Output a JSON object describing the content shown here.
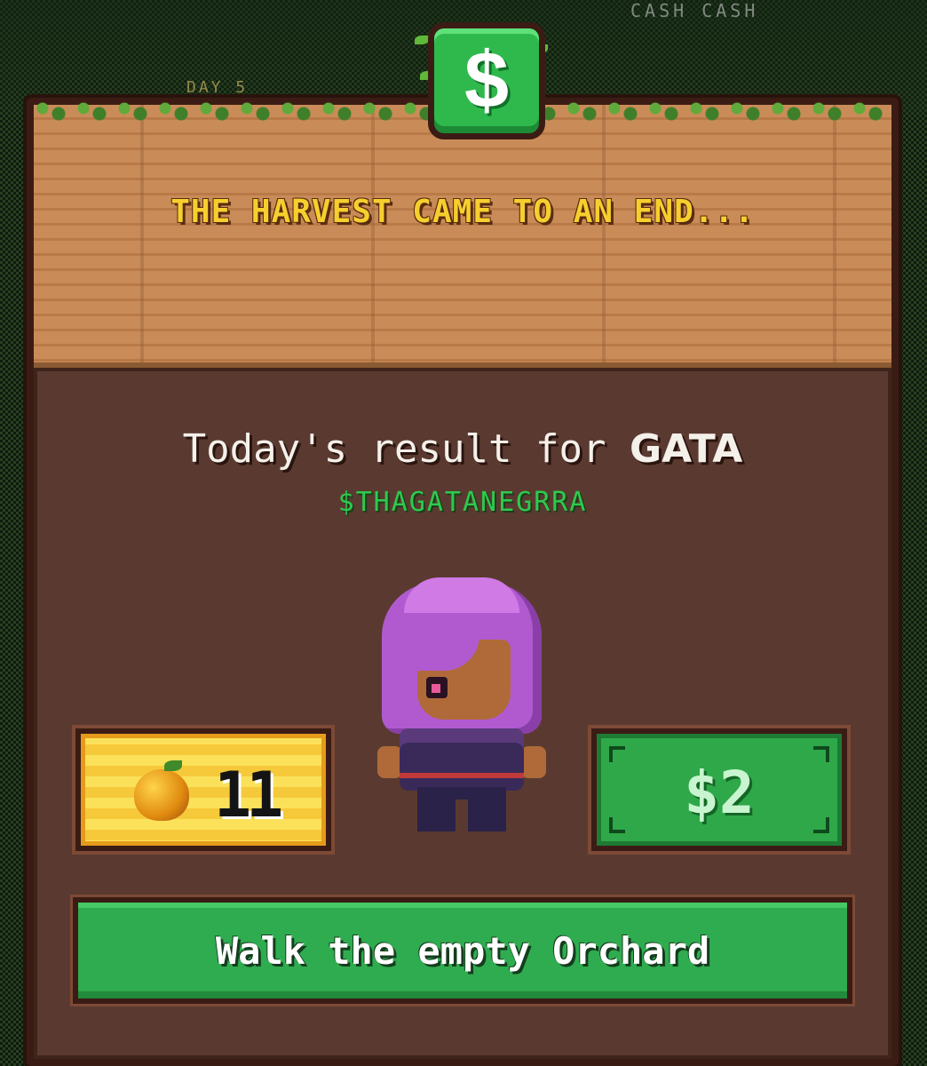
{
  "background": {
    "hud_text": "CASH CASH",
    "day_text": "DAY 5"
  },
  "modal": {
    "title": "THE HARVEST CAME TO AN END...",
    "badge_symbol": "$",
    "result_prefix": "Today's result for ",
    "player_name": "GATA",
    "cashtag": "$THAGATANEGRRA",
    "apples": {
      "icon": "golden-apple-icon",
      "count": "11"
    },
    "cash": {
      "value": "$2"
    },
    "action_label": "Walk the empty Orchard"
  },
  "colors": {
    "title": "#f6cf2f",
    "cashtag": "#2fc94e",
    "button": "#2fac4f",
    "cash_card": "#2fa84a",
    "apple_card": "#fbe15a",
    "hair": "#b15ad0"
  }
}
